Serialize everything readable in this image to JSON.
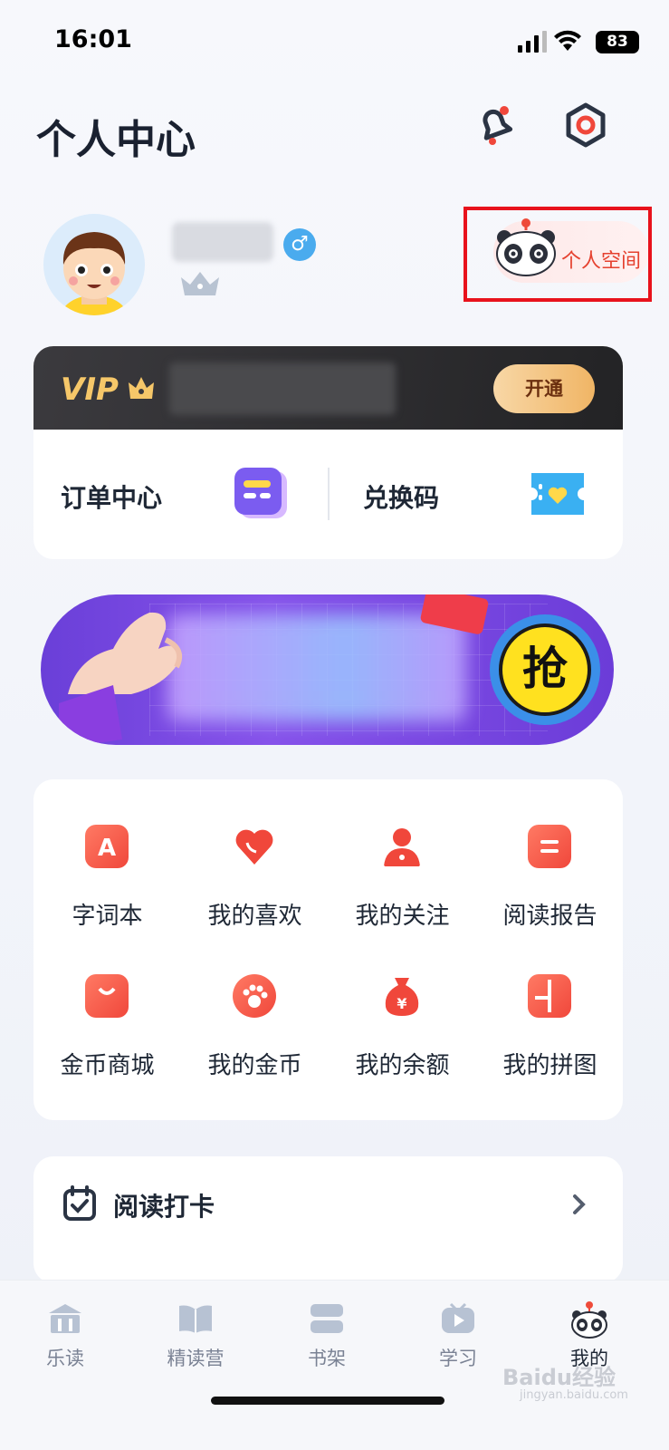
{
  "status": {
    "time": "16:01",
    "battery": "83"
  },
  "header": {
    "title": "个人中心"
  },
  "profile": {
    "gender_symbol": "♂",
    "space_label": "个人空间"
  },
  "vip": {
    "logo": "VIP",
    "open_label": "开通"
  },
  "services": {
    "order_label": "订单中心",
    "code_label": "兑换码"
  },
  "banner": {
    "grab_label": "抢"
  },
  "grid": {
    "items": [
      {
        "label": "字词本",
        "icon": "letter-a-icon"
      },
      {
        "label": "我的喜欢",
        "icon": "heart-icon"
      },
      {
        "label": "我的关注",
        "icon": "person-icon"
      },
      {
        "label": "阅读报告",
        "icon": "report-icon"
      },
      {
        "label": "金币商城",
        "icon": "shopping-bag-icon"
      },
      {
        "label": "我的金币",
        "icon": "paw-coin-icon"
      },
      {
        "label": "我的余额",
        "icon": "money-bag-icon"
      },
      {
        "label": "我的拼图",
        "icon": "puzzle-icon"
      }
    ]
  },
  "checkin": {
    "label": "阅读打卡"
  },
  "tabs": [
    {
      "label": "乐读",
      "icon": "library-icon"
    },
    {
      "label": "精读营",
      "icon": "book-icon"
    },
    {
      "label": "书架",
      "icon": "bookshelf-icon"
    },
    {
      "label": "学习",
      "icon": "tv-play-icon"
    },
    {
      "label": "我的",
      "icon": "panda-icon"
    }
  ],
  "watermark": {
    "brand": "Baidu经验",
    "url": "jingyan.baidu.com"
  },
  "colors": {
    "accent": "#f0473b",
    "vip_gold": "#f6c769",
    "banner_purple": "#7a48e4",
    "highlight_box": "#e8121c"
  }
}
